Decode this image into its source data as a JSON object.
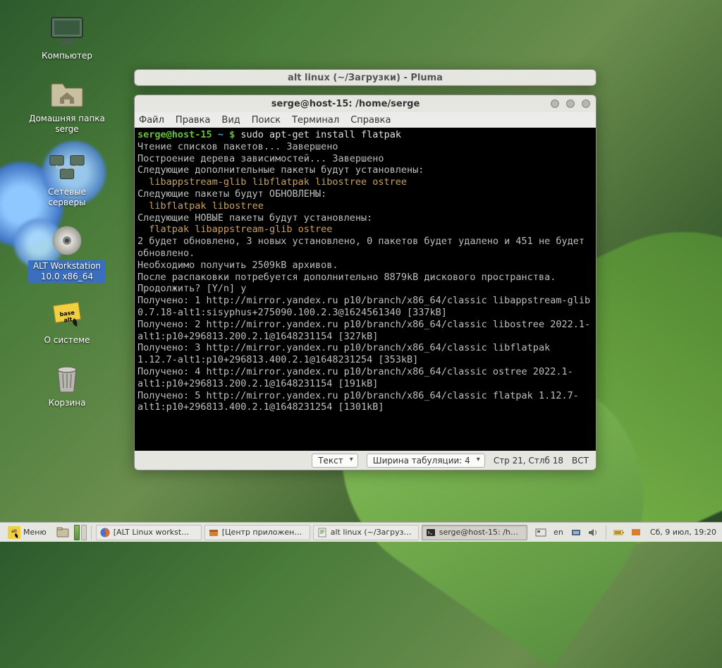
{
  "desktop": {
    "icons": [
      {
        "name": "computer",
        "label": "Компьютер"
      },
      {
        "name": "home",
        "label": "Домашняя папка serge"
      },
      {
        "name": "network",
        "label": "Сетевые серверы"
      },
      {
        "name": "disc",
        "label": "ALT Workstation 10.0 x86_64",
        "selected": true
      },
      {
        "name": "about",
        "label": "О системе"
      },
      {
        "name": "trash",
        "label": "Корзина"
      }
    ]
  },
  "pluma": {
    "title": "alt linux (~/Загрузки) - Pluma",
    "statusbar": {
      "mode": "Текст",
      "tabwidth_label": "Ширина табуляции:  4",
      "cursor": "Стр 21, Стлб 18",
      "ins": "ВСТ"
    }
  },
  "terminal": {
    "title": "serge@host-15: /home/serge",
    "menus": [
      "Файл",
      "Правка",
      "Вид",
      "Поиск",
      "Терминал",
      "Справка"
    ],
    "prompt": {
      "user": "serge@host-15",
      "path": "~",
      "sym": "$"
    },
    "command": "sudo apt-get install flatpak",
    "lines": [
      "Чтение списков пакетов... Завершено",
      "Построение дерева зависимостей... Завершено",
      "Следующие дополнительные пакеты будут установлены:",
      "  libappstream-glib libflatpak libostree ostree",
      "Следующие пакеты будут ОБНОВЛЕНЫ:",
      "  libflatpak libostree",
      "Следующие НОВЫЕ пакеты будут установлены:",
      "  flatpak libappstream-glib ostree",
      "2 будет обновлено, 3 новых установлено, 0 пакетов будет удалено и 451 не будет обновлено.",
      "Необходимо получить 2509kB архивов.",
      "После распаковки потребуется дополнительно 8879kB дискового пространства.",
      "Продолжить? [Y/n] y",
      "Получено: 1 http://mirror.yandex.ru p10/branch/x86_64/classic libappstream-glib 0.7.18-alt1:sisyphus+275090.100.2.3@1624561340 [337kB]",
      "Получено: 2 http://mirror.yandex.ru p10/branch/x86_64/classic libostree 2022.1-alt1:p10+296813.200.2.1@1648231154 [327kB]",
      "Получено: 3 http://mirror.yandex.ru p10/branch/x86_64/classic libflatpak 1.12.7-alt1:p10+296813.400.2.1@1648231254 [353kB]",
      "Получено: 4 http://mirror.yandex.ru p10/branch/x86_64/classic ostree 2022.1-alt1:p10+296813.200.2.1@1648231154 [191kB]",
      "Получено: 5 http://mirror.yandex.ru p10/branch/x86_64/classic flatpak 1.12.7-alt1:p10+296813.400.2.1@1648231254 [1301kB]"
    ]
  },
  "taskbar": {
    "menu": "Меню",
    "tasks": [
      {
        "label": "[ALT Linux workst…",
        "icon": "firefox"
      },
      {
        "label": "[Центр приложен…",
        "icon": "app-center"
      },
      {
        "label": "alt linux (~/Загруз…",
        "icon": "pluma"
      },
      {
        "label": "serge@host-15: /h…",
        "icon": "terminal",
        "active": true
      }
    ],
    "lang": "en",
    "clock": "Сб,  9 июл, 19:20"
  }
}
